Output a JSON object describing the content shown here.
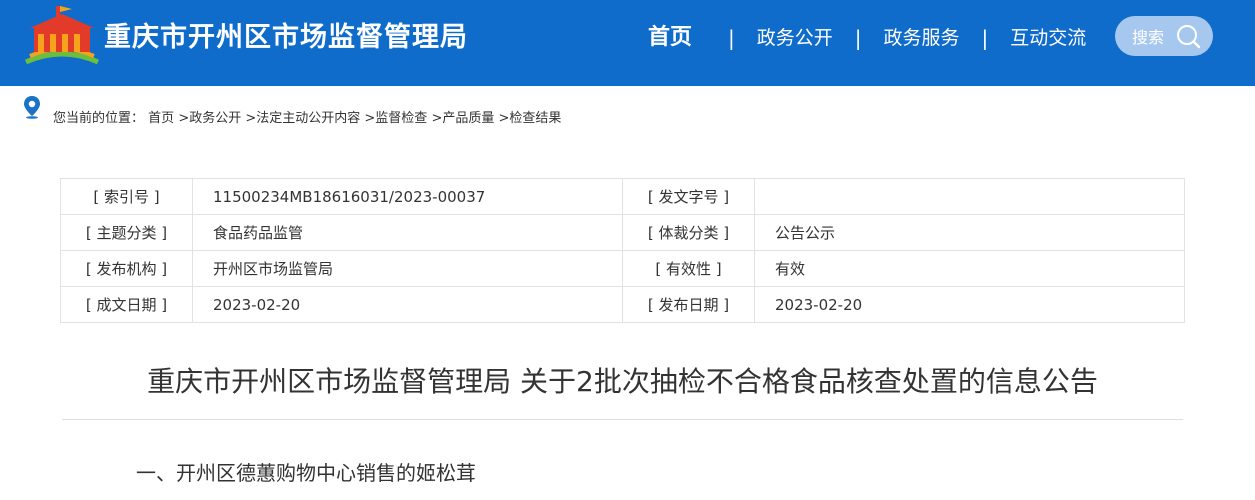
{
  "header": {
    "site_title": "重庆市开州区市场监督管理局",
    "nav": {
      "home": "首页",
      "gov_open": "政务公开",
      "gov_service": "政务服务",
      "interaction": "互动交流",
      "separator": "|"
    },
    "search_label": "搜索"
  },
  "breadcrumb": {
    "prefix": "您当前的位置：",
    "items": [
      "首页",
      ">政务公开",
      ">法定主动公开内容",
      ">监督检查",
      ">产品质量",
      ">检查结果"
    ]
  },
  "meta": {
    "rows": [
      {
        "k1": "[ 索引号 ]",
        "v1": "11500234MB18616031/2023-00037",
        "k2": "[ 发文字号 ]",
        "v2": ""
      },
      {
        "k1": "[ 主题分类 ]",
        "v1": "食品药品监管",
        "k2": "[ 体裁分类 ]",
        "v2": "公告公示"
      },
      {
        "k1": "[ 发布机构 ]",
        "v1": "开州区市场监管局",
        "k2": "[ 有效性 ]",
        "v2": "有效"
      },
      {
        "k1": "[ 成文日期 ]",
        "v1": "2023-02-20",
        "k2": "[ 发布日期 ]",
        "v2": "2023-02-20"
      }
    ]
  },
  "article": {
    "title": "重庆市开州区市场监督管理局 关于2批次抽检不合格食品核查处置的信息公告",
    "section_1": "一、开州区德蕙购物中心销售的姬松茸"
  },
  "colors": {
    "header_bg": "#0f6ccb",
    "search_bg": "#a7c8ee",
    "logo_red": "#e23b2a",
    "logo_orange": "#f7a21b",
    "logo_green": "#6bbf3c"
  }
}
